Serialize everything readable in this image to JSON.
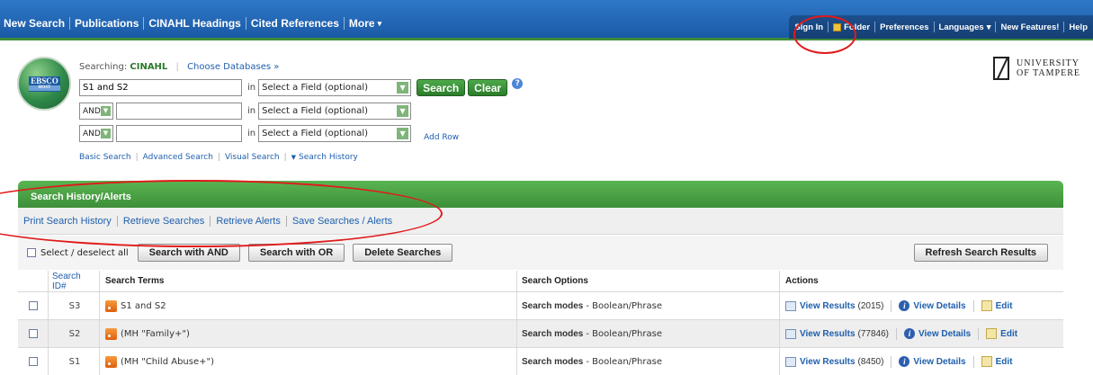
{
  "nav": {
    "left": [
      "New Search",
      "Publications",
      "CINAHL Headings",
      "Cited References",
      "More"
    ],
    "right": [
      "Sign In",
      "Folder",
      "Preferences",
      "Languages",
      "New Features!",
      "Help"
    ]
  },
  "logo": {
    "top": "EBSCO",
    "bottom": "HOST"
  },
  "university": {
    "line1": "UNIVERSITY",
    "line2": "OF TAMPERE"
  },
  "search": {
    "searching_label": "Searching:",
    "database": "CINAHL",
    "choose_db": "Choose Databases »",
    "row1_value": "S1 and S2",
    "in_label": "in",
    "field_placeholder": "Select a Field (optional)",
    "op2": "AND",
    "op3": "AND",
    "search_btn": "Search",
    "clear_btn": "Clear",
    "add_row": "Add Row",
    "links": [
      "Basic Search",
      "Advanced Search",
      "Visual Search",
      "Search History"
    ]
  },
  "history": {
    "title": "Search History/Alerts",
    "links": [
      "Print Search History",
      "Retrieve Searches",
      "Retrieve Alerts",
      "Save Searches / Alerts"
    ],
    "select_all": "Select / deselect all",
    "btn_and": "Search with AND",
    "btn_or": "Search with OR",
    "btn_delete": "Delete Searches",
    "btn_refresh": "Refresh Search Results",
    "columns": [
      "Search ID#",
      "Search Terms",
      "Search Options",
      "Actions"
    ],
    "rows": [
      {
        "id": "S3",
        "terms": "S1 and S2",
        "opt_label": "Search modes",
        "opt_value": "- Boolean/Phrase",
        "count": "(2015)"
      },
      {
        "id": "S2",
        "terms": "(MH \"Family+\")",
        "opt_label": "Search modes",
        "opt_value": "- Boolean/Phrase",
        "count": "(77846)"
      },
      {
        "id": "S1",
        "terms": "(MH \"Child Abuse+\")",
        "opt_label": "Search modes",
        "opt_value": "- Boolean/Phrase",
        "count": "(8450)"
      }
    ],
    "view_results": "View Results",
    "view_details": "View Details",
    "edit": "Edit"
  }
}
